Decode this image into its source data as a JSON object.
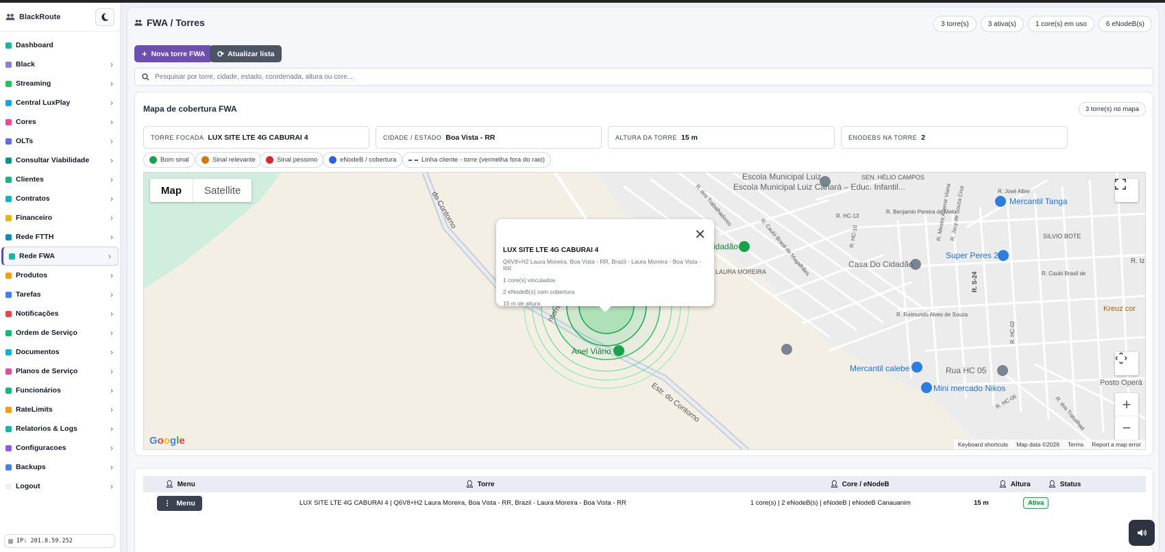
{
  "app": {
    "name": "BlackRoute"
  },
  "sidebar": {
    "items": [
      {
        "label": "Dashboard",
        "color": "#14b8a6"
      },
      {
        "label": "Black",
        "color": "#8b7fd6"
      },
      {
        "label": "Streaming",
        "color": "#22c55e"
      },
      {
        "label": "Central LuxPlay",
        "color": "#0ea5e9"
      },
      {
        "label": "Cores",
        "color": "#ec4899"
      },
      {
        "label": "OLTs",
        "color": "#6366f1"
      },
      {
        "label": "Consultar Viabilidade",
        "color": "#0d9488"
      },
      {
        "label": "Clientes",
        "color": "#10b981"
      },
      {
        "label": "Contratos",
        "color": "#06b6d4"
      },
      {
        "label": "Financeiro",
        "color": "#eab308"
      },
      {
        "label": "Rede FTTH",
        "color": "#0891b2"
      },
      {
        "label": "Rede FWA",
        "color": "#14b8a6"
      },
      {
        "label": "Produtos",
        "color": "#f59e0b"
      },
      {
        "label": "Tarefas",
        "color": "#3b82f6"
      },
      {
        "label": "Notificações",
        "color": "#ef4444"
      },
      {
        "label": "Ordem de Serviço",
        "color": "#10b981"
      },
      {
        "label": "Documentos",
        "color": "#06b6d4"
      },
      {
        "label": "Planos de Serviço",
        "color": "#ec4899"
      },
      {
        "label": "Funcionários",
        "color": "#10b981"
      },
      {
        "label": "RateLimits",
        "color": "#f59e0b"
      },
      {
        "label": "Relatorios & Logs",
        "color": "#14b8a6"
      },
      {
        "label": "Configuracoes",
        "color": "#8b5cf6"
      },
      {
        "label": "Backups",
        "color": "#3b82f6"
      },
      {
        "label": "Logout",
        "color": "#f1f1f1"
      }
    ],
    "ip": "IP: 201.8.59.252"
  },
  "header": {
    "title": "FWA / Torres",
    "pills": [
      "3 torre(s)",
      "3 ativa(s)",
      "1 core(s) em uso",
      "6 eNodeB(s)"
    ]
  },
  "toolbar": {
    "new_label": "Nova torre FWA",
    "refresh_label": "Atualizar lista"
  },
  "search": {
    "placeholder": "Pesquisar por torre, cidade, estado, coordenada, altura ou core..."
  },
  "map_card": {
    "title": "Mapa de cobertura FWA",
    "count": "3 torre(s) no mapa",
    "info": [
      {
        "key": "TORRE FOCADA",
        "value": "LUX SITE LTE 4G CABURAI 4"
      },
      {
        "key": "CIDADE / ESTADO",
        "value": "Boa Vista - RR"
      },
      {
        "key": "ALTURA DA TORRE",
        "value": "15 m"
      },
      {
        "key": "ENODEBS NA TORRE",
        "value": "2"
      }
    ],
    "legend": [
      {
        "label": "Bom sinal",
        "color": "#16a34a"
      },
      {
        "label": "Sinal relevante",
        "color": "#d97706"
      },
      {
        "label": "Sinal pessimo",
        "color": "#dc2626"
      },
      {
        "label": "eNodeB / cobertura",
        "color": "#2563eb"
      },
      {
        "label": "Linha cliente - torre (vermelha fora do raio)",
        "color": "#3b5ab8"
      }
    ]
  },
  "map": {
    "type_map": "Map",
    "type_satellite": "Satellite",
    "google": "Google",
    "attribution": [
      "Keyboard shortcuts",
      "Map data ©2026",
      "Terms",
      "Report a map error"
    ],
    "labels": {
      "school": "Escola Municipal Luiz Canará – Educ. Infantil...",
      "sen_helio": "SEN. HÉLIO CAMPOS",
      "mercantil_tanga": "Mercantil Tanga",
      "silvio": "SILVIO BOTE",
      "casa_cidadao": "Casa Do Cidadão",
      "cidadao": "cidadão",
      "laura": "LAURA MOREIRA",
      "super_peres": "Super Peres 2",
      "kreuz": "Kreuz cor",
      "anel": "Anel Viário",
      "contorno1": "do Contorno",
      "contorno2": "Estr. do Contorno",
      "contorno3": "ntorno",
      "mercantil_calebe": "Mercantil calebe",
      "rua_hc05": "Rua HC 05",
      "mini_nikos": "Mini mercado Nikos",
      "posto": "Posto Operá",
      "trabalhadores": "R. dos Trabalhadores",
      "trabalhad2": "R. dos Trabalhad",
      "hc13": "R. HC-13",
      "benjamin": "R. Benjamin Pereira de Melo",
      "jose_alber": "R. José Alber",
      "caubi": "R. Caubi Brasil de Magalhães",
      "caubi2": "R. Caubi Brasil de",
      "raimundo": "R. Raimundo Alves de Souza",
      "rs24": "R. S-24",
      "adernir": "R. Mestre Adernir Viana",
      "jacy": "R. Jacy de Souza Cruz",
      "hc02": "R. HC-02",
      "hc06": "R. HC-06",
      "hc10": "R. HC-10",
      "iz": "R. Iz"
    }
  },
  "popup": {
    "title": "LUX SITE LTE 4G CABURAI 4",
    "lines": [
      "Q6V8+H2 Laura Moreira, Boa Vista - RR, Brazil - Laura Moreira - Boa Vista - RR",
      "1 core(s) vinculados",
      "2 eNodeB(s) com cobertura",
      "15 m de altura"
    ]
  },
  "table": {
    "headers": [
      "Menu",
      "Torre",
      "Core / eNodeB",
      "Altura",
      "Status"
    ],
    "rows": [
      {
        "menu": "Menu",
        "torre": "LUX SITE LTE 4G CABURAI 4 | Q6V8+H2 Laura Moreira, Boa Vista - RR, Brazil - Laura Moreira - Boa Vista - RR",
        "core": "1 core(s) | 2 eNodeB(s) | eNodeB | eNodeB Canauanim",
        "altura": "15 m",
        "status": "Ativa"
      }
    ]
  }
}
